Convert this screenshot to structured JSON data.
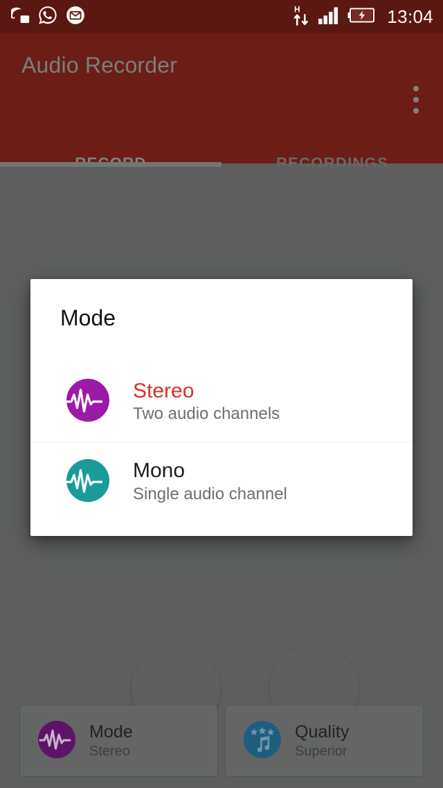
{
  "status_bar": {
    "time": "13:04",
    "left_icons": [
      {
        "name": "discord-icon",
        "label": "Discord"
      },
      {
        "name": "whatsapp-icon",
        "label": "WhatsApp"
      },
      {
        "name": "email-icon",
        "label": "Email"
      }
    ],
    "right_icons": [
      {
        "name": "hspa-network-icon",
        "label": "H"
      },
      {
        "name": "signal-bars-icon",
        "label": "Signal"
      },
      {
        "name": "battery-charging-icon",
        "label": "Battery charging"
      }
    ]
  },
  "app_bar": {
    "title": "Audio Recorder",
    "overflow_label": "More options"
  },
  "tabs": [
    {
      "label": "RECORD",
      "active": true
    },
    {
      "label": "RECORDINGS",
      "active": false
    }
  ],
  "record_screen": {
    "mic_icon": "microphone-icon",
    "vu_meter_rows": 2,
    "vu_meter_columns": 10,
    "fab_record": "record-button",
    "fab_stop": "stop-button"
  },
  "settings_cards": [
    {
      "icon": "waveform-icon",
      "title": "Mode",
      "value": "Stereo",
      "icon_color": "#5e1466"
    },
    {
      "icon": "quality-stars-music-icon",
      "title": "Quality",
      "value": "Superior",
      "icon_color": "#1d5e80"
    }
  ],
  "dialog": {
    "title": "Mode",
    "options": [
      {
        "name": "Stereo",
        "description": "Two audio channels",
        "selected": true,
        "icon": "waveform-icon",
        "icon_color": "#9c1aa8"
      },
      {
        "name": "Mono",
        "description": "Single audio channel",
        "selected": false,
        "icon": "waveform-icon",
        "icon_color": "#1b9a9a"
      }
    ]
  },
  "colors": {
    "status_bar_bg": "#5b1711",
    "app_bar_bg": "#6b1d16",
    "scrim_bg": "#5c5f5e",
    "accent_selected": "#d93025",
    "dialog_bg": "#ffffff"
  }
}
